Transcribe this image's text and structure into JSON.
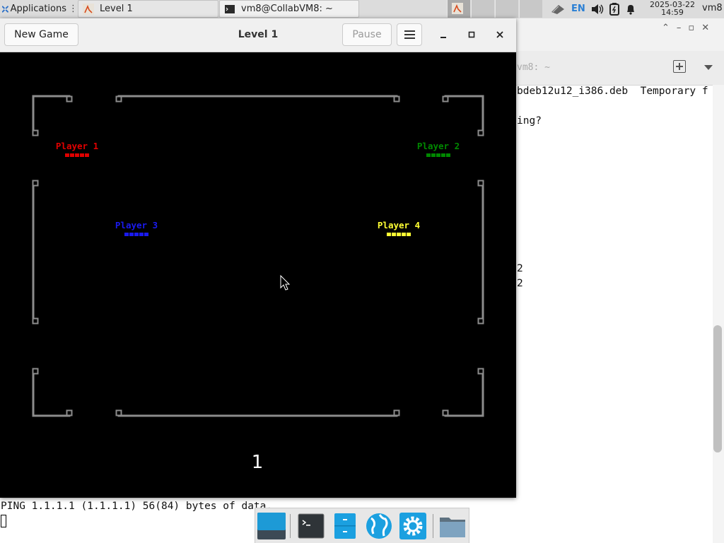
{
  "panel": {
    "apps_menu_label": "Applications",
    "tasks": [
      {
        "label": "Level 1"
      },
      {
        "label": "vm8@CollabVM8: ~"
      }
    ],
    "tray": {
      "lang": "EN"
    },
    "clock": {
      "date": "2025-03-22",
      "time": "14:59"
    },
    "user": "vm8"
  },
  "terminal": {
    "tab_title": "vm8: ~",
    "lines": [
      "bdeb12u12_i386.deb  Temporary f",
      "ing?",
      "2",
      "2"
    ],
    "ping_line": "PING 1.1.1.1 (1.1.1.1) 56(84) bytes of data."
  },
  "game": {
    "title": "Level 1",
    "new_game_label": "New Game",
    "pause_label": "Pause",
    "players": [
      {
        "name": "Player 1",
        "color": "#e00000",
        "lives": 5
      },
      {
        "name": "Player 2",
        "color": "#008800",
        "lives": 5
      },
      {
        "name": "Player 3",
        "color": "#1a1aee",
        "lives": 5
      },
      {
        "name": "Player 4",
        "color": "#ffff33",
        "lives": 5
      }
    ],
    "level_number": "1",
    "wall_color": "#8c8c8c"
  },
  "dock": {
    "items": [
      "show-desktop",
      "terminal",
      "file-manager",
      "web-browser",
      "settings",
      "home-folder"
    ]
  }
}
